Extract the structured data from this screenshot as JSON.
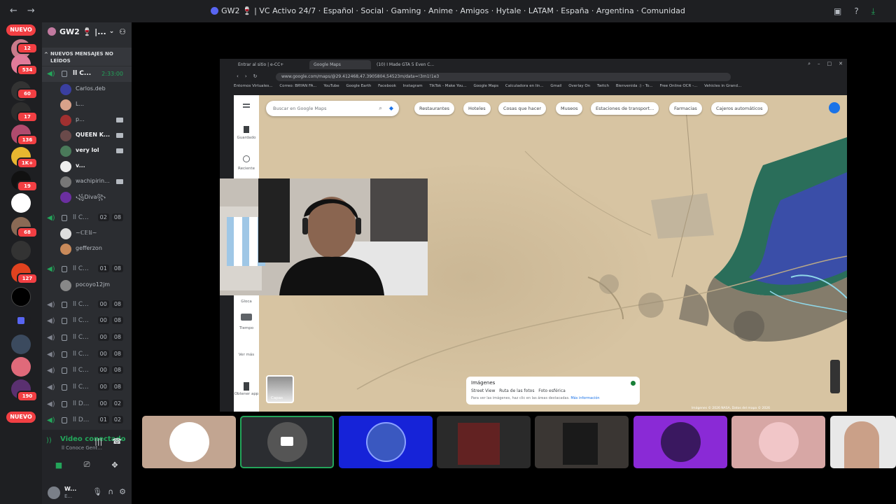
{
  "window": {
    "title": "GW2 🍷 | VC Activo 24/7 · Español · Social · Gaming · Anime · Amigos · Hytale · LATAM · España · Argentina · Comunidad",
    "back": "←",
    "forward": "→"
  },
  "rail": {
    "nuevo_top": "NUEVO",
    "nuevo_bottom": "NUEVO",
    "badges": [
      "12",
      "534",
      "60",
      "17",
      "136",
      "1K+",
      "19",
      "68",
      "127",
      "190"
    ]
  },
  "sidebar": {
    "guild_name": "GW2 🍷 |...",
    "new_messages": "NUEVOS MENSAJES NO LEÍDOS",
    "channels": [
      {
        "name": "ll C...",
        "timer": "2:33:00",
        "active": true
      },
      {
        "name": "ll C...",
        "t1": "02",
        "t2": "08"
      },
      {
        "name": "ll C...",
        "t1": "01",
        "t2": "08"
      },
      {
        "name": "ll C...",
        "t1": "00",
        "t2": "08"
      },
      {
        "name": "ll C...",
        "t1": "00",
        "t2": "08"
      },
      {
        "name": "ll C...",
        "t1": "00",
        "t2": "08"
      },
      {
        "name": "ll C...",
        "t1": "00",
        "t2": "08"
      },
      {
        "name": "ll C...",
        "t1": "00",
        "t2": "08"
      },
      {
        "name": "ll C...",
        "t1": "00",
        "t2": "08"
      },
      {
        "name": "ll D...",
        "t1": "00",
        "t2": "02"
      },
      {
        "name": "ll D...",
        "t1": "01",
        "t2": "02"
      }
    ],
    "users": [
      "Carlos.deb",
      "L...",
      "p...",
      "QUEEN K...",
      "very lol",
      "v...",
      "wachipirin...",
      "꧁Diva꧂",
      "~ℂ𝔼𝕝𝕚~",
      "gefferzon",
      "pocoyo12jm"
    ],
    "voice": {
      "status": "Video conectado",
      "server": "ll Conoce Gent..."
    },
    "user": {
      "name": "W...",
      "sub": "E..."
    }
  },
  "browser": {
    "tabs": [
      "Entrar al sitio | e-CC+",
      "Google Maps",
      "(10) I Made GTA 5 Even C..."
    ],
    "url": "www.google.com/maps/@29.412468,47.3905804,54523m/data=!3m1!1e3",
    "bookmarks": [
      "Entornos Virtuales...",
      "Correo: BRYAN FA...",
      "YouTube",
      "Google Earth",
      "Facebook",
      "Instagram",
      "TikTok - Make You...",
      "Google Maps",
      "Calculadora en lín...",
      "Gmail",
      "Overlay On",
      "Twitch",
      "Bienvenida :) - To...",
      "Free Online OCR -...",
      "Vehicles in Grand..."
    ]
  },
  "maps": {
    "search_placeholder": "Buscar en Google Maps",
    "chips": [
      "Restaurantes",
      "Hoteles",
      "Cosas que hacer",
      "Museos",
      "Estaciones de transport...",
      "Farmacias",
      "Cajeros automáticos"
    ],
    "left_nav": [
      "Guardado",
      "Reciente",
      "Gloca",
      "Tiempo",
      "Ver más",
      "Obtener app"
    ],
    "capas": "Capas",
    "images_card": {
      "title": "Imágenes",
      "street_view": "Street View",
      "ruta_fotos": "Ruta de las fotos",
      "foto_esferica": "Foto esférica",
      "desc": "Para ver las imágenes, haz clic en las áreas destacadas.",
      "more": "Más información"
    },
    "footer": "Imágenes © 2026 NASA, Datos del mapa © 2026"
  }
}
